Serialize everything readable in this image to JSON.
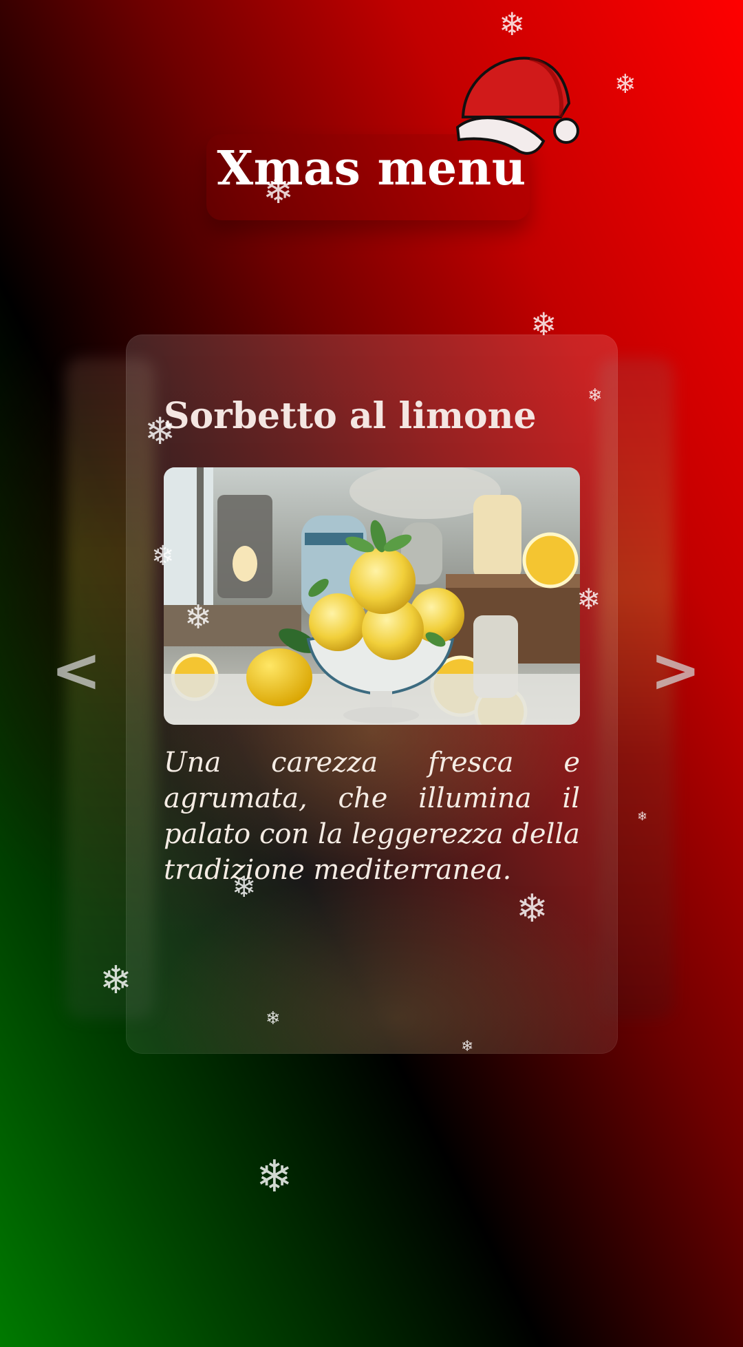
{
  "header": {
    "title": "Xmas menu"
  },
  "menu": {
    "current_item": {
      "name": "Sorbetto al limone",
      "description": "Una carezza fresca e agrumata, che illumina il palato con la leggerezza della tradizione mediterranea."
    },
    "prev_label": "<",
    "next_label": ">"
  },
  "decorations": {
    "snowflake_glyph": "❄",
    "hat_icon": "santa-hat-icon"
  },
  "colors": {
    "red": "#ff0000",
    "green": "#007a00",
    "text": "#ffffff"
  }
}
